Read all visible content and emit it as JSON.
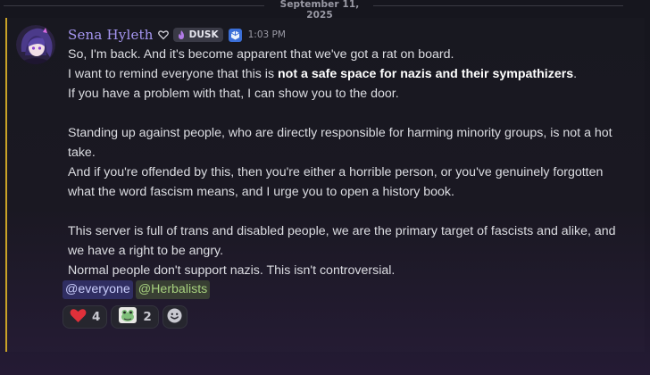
{
  "divider": {
    "date": "September 11, 2025"
  },
  "message": {
    "author": "Sena Hyleth",
    "guild_tag": "DUSK",
    "timestamp": "1:03 PM",
    "lines": {
      "l1": "So, I'm back. And it's become apparent that we've got a rat on board.",
      "l2_pre": "I want to remind everyone that this is ",
      "l2_bold": "not a safe space for nazis and their sympathizers",
      "l2_post": ".",
      "l3": "If you have a problem with that, I can show you to the door.",
      "l4": "Standing up against people, who are directly responsible for harming minority groups, is not a hot take.",
      "l5": "And if you're offended by this, then you're either a horrible person, or you've genuinely forgotten what the word fascism means, and I urge you to open a history book.",
      "l6": "This server is full of trans and disabled people, we are the primary target of fascists and alike, and we have a right to be angry.",
      "l7": "Normal people don't support nazis. This isn't controversial."
    },
    "mentions": [
      "@everyone",
      "@Herbalists"
    ]
  },
  "reactions": [
    {
      "icon": "red-heart-icon",
      "count": "4"
    },
    {
      "icon": "frog-sticker-icon",
      "count": "2"
    }
  ],
  "colors": {
    "username": "#a596f0",
    "accent_bar": "#c9a227",
    "mention_everyone": "#c9cdfb",
    "mention_role": "#a6d07e"
  }
}
